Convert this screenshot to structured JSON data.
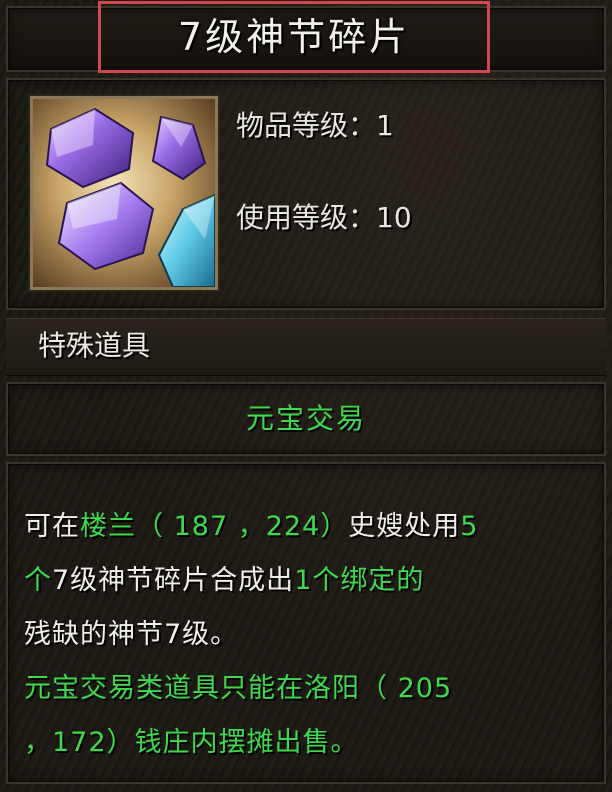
{
  "tooltip": {
    "title": "7级神节碎片",
    "stats": {
      "item_level_label": "物品等级：",
      "item_level_value": "1",
      "use_level_label": "使用等级：",
      "use_level_value": "10"
    },
    "category": "特殊道具",
    "trade_type": "元宝交易",
    "description": {
      "line1": {
        "a": "可在",
        "b": "楼兰",
        "c": "（ 187 ，224）",
        "d": "史嫂处用",
        "e": "5"
      },
      "line2": {
        "a": "个",
        "b": "7级神节碎片",
        "c": "合成出",
        "d": "1个绑定的"
      },
      "line3": {
        "a": "残缺的神节7级。"
      },
      "line4": {
        "a": "元宝交易类道具只能在洛阳（ 205"
      },
      "line5": {
        "a": "，172）钱庄内摆摊出售。"
      }
    },
    "colors": {
      "highlight_green": "#3fd94e",
      "text_white": "#f0eee8",
      "annotation_red": "#d0474f"
    },
    "icon": "purple-crystal-shards-icon"
  }
}
